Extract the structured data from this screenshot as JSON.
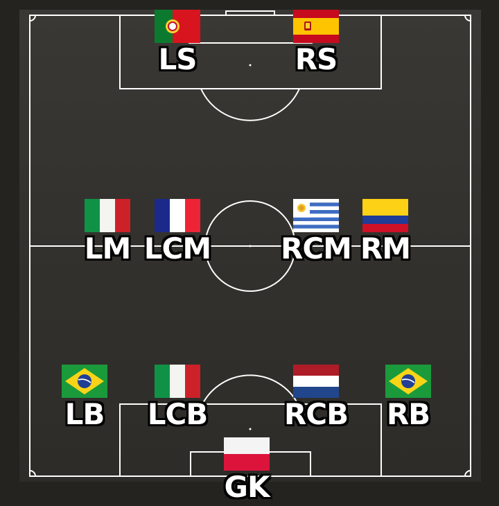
{
  "formation": {
    "players": [
      {
        "id": "ls",
        "label": "LS",
        "flag": "portugal-flag-icon"
      },
      {
        "id": "rs",
        "label": "RS",
        "flag": "spain-flag-icon"
      },
      {
        "id": "lm",
        "label": "LM",
        "flag": "italy-flag-icon"
      },
      {
        "id": "lcm",
        "label": "LCM",
        "flag": "france-flag-icon"
      },
      {
        "id": "rcm",
        "label": "RCM",
        "flag": "uruguay-flag-icon"
      },
      {
        "id": "rm",
        "label": "RM",
        "flag": "colombia-flag-icon"
      },
      {
        "id": "lb",
        "label": "LB",
        "flag": "brazil-flag-icon"
      },
      {
        "id": "lcb",
        "label": "LCB",
        "flag": "italy-flag-icon"
      },
      {
        "id": "rcb",
        "label": "RCB",
        "flag": "netherlands-flag-icon"
      },
      {
        "id": "rb",
        "label": "RB",
        "flag": "brazil-flag-icon"
      },
      {
        "id": "gk",
        "label": "GK",
        "flag": "poland-flag-icon"
      }
    ]
  },
  "colors": {
    "background": "#25231f",
    "pitch": "#33312d",
    "lines": "#ffffff",
    "label_text": "#ffffff",
    "label_outline": "#000000"
  }
}
